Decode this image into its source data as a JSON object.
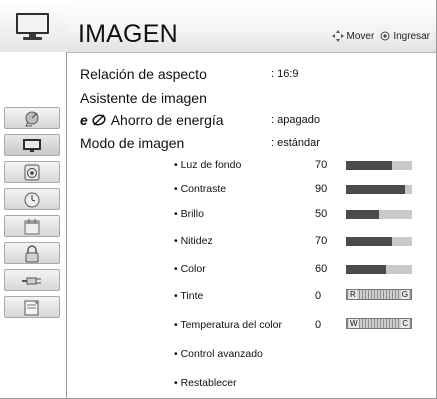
{
  "header": {
    "title": "IMAGEN",
    "hint_move": "Mover",
    "hint_enter": "Ingresar"
  },
  "sidebar": {
    "icons": [
      {
        "name": "satellite-dish-icon",
        "selected": false
      },
      {
        "name": "monitor-icon",
        "selected": true
      },
      {
        "name": "speaker-icon",
        "selected": false
      },
      {
        "name": "clock-icon",
        "selected": false
      },
      {
        "name": "calendar-icon",
        "selected": false
      },
      {
        "name": "lock-icon",
        "selected": false
      },
      {
        "name": "connector-icon",
        "selected": false
      },
      {
        "name": "document-icon",
        "selected": false
      }
    ]
  },
  "menu": {
    "aspect_ratio_label": "Relación de aspecto",
    "aspect_ratio_value": ": 16:9",
    "picture_wizard_label": "Asistente de imagen",
    "energy_saving_prefix": "e",
    "energy_saving_label": "Ahorro de energía",
    "energy_saving_value": ": apagado",
    "picture_mode_label": "Modo de imagen",
    "picture_mode_value": ": estándar",
    "settings": [
      {
        "label": "• Luz de fondo",
        "value": "70",
        "level": 0.7
      },
      {
        "label": "• Contraste",
        "value": "90",
        "level": 0.9
      },
      {
        "label": "• Brillo",
        "value": "50",
        "level": 0.5
      },
      {
        "label": "• Nitidez",
        "value": "70",
        "level": 0.7
      },
      {
        "label": "• Color",
        "value": "60",
        "level": 0.6
      }
    ],
    "tint": {
      "label": "• Tinte",
      "value": "0",
      "left": "R",
      "right": "G"
    },
    "color_temp": {
      "label": "• Temperatura del color",
      "value": "0",
      "left": "W",
      "right": "C"
    },
    "advanced_label": "• Control avanzado",
    "reset_label": "• Restablecer"
  }
}
